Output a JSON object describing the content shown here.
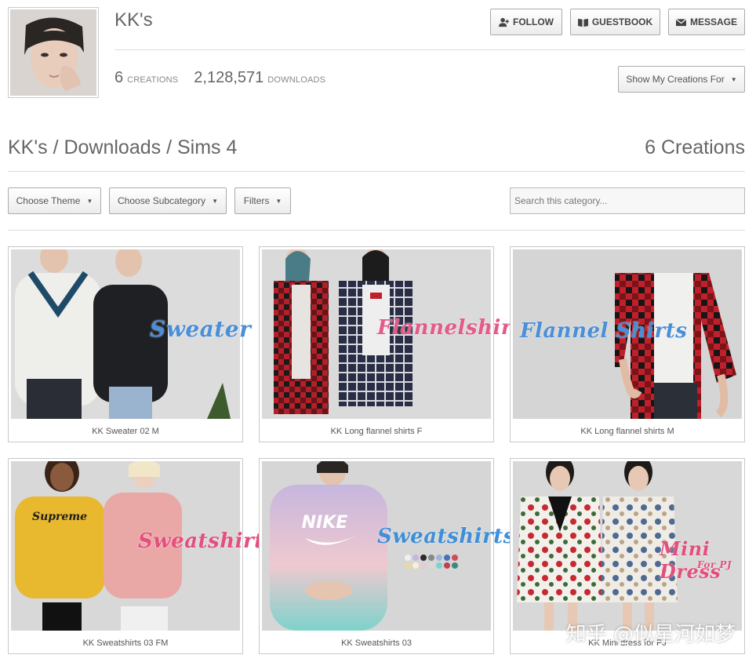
{
  "profile": {
    "name": "KK's",
    "creations_count": "6",
    "creations_label": "CREATIONS",
    "downloads_count": "2,128,571",
    "downloads_label": "DOWNLOADS"
  },
  "actions": {
    "follow": "FOLLOW",
    "guestbook": "GUESTBOOK",
    "message": "MESSAGE",
    "show_creations": "Show My Creations For"
  },
  "page": {
    "breadcrumb": "KK's / Downloads / Sims 4",
    "count_label": "6 Creations"
  },
  "filters": {
    "theme": "Choose Theme",
    "subcategory": "Choose Subcategory",
    "filters": "Filters",
    "search_placeholder": "Search this category..."
  },
  "creations": [
    {
      "title": "KK Sweater 02 M",
      "overlay": "Sweater",
      "overlay_color": "#4a8fd8"
    },
    {
      "title": "KK Long flannel shirts F",
      "overlay": "Flannelshirts",
      "overlay_color": "#e45a8a"
    },
    {
      "title": "KK Long flannel shirts M",
      "overlay": "Flannel Shirts",
      "overlay_color": "#4a8fd8"
    },
    {
      "title": "KK Sweatshirts 03 FM",
      "overlay": "Sweatshirts",
      "overlay_color": "#e4507e"
    },
    {
      "title": "KK Sweatshirts 03",
      "overlay": "Sweatshirts",
      "overlay_color": "#3f8fd8"
    },
    {
      "title": "KK Mini dress for PJ",
      "overlay": "Mini Dress",
      "overlay_sub": "For PJ",
      "overlay_color": "#e4507e"
    }
  ],
  "watermark": "知乎 @似星河如梦",
  "colors": {
    "border": "#c8c8c8",
    "text": "#555555",
    "button_bg": "#f0f0f0"
  }
}
